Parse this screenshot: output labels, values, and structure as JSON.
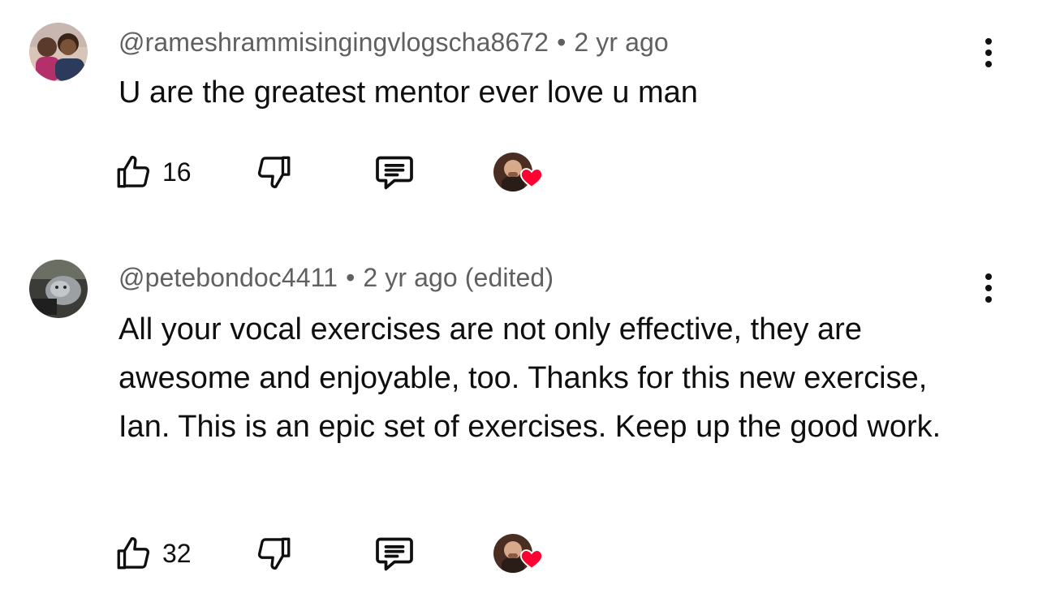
{
  "comments": [
    {
      "author": "@rameshrammisingingvlogscha8672",
      "time": "2 yr ago",
      "text": "U are the greatest mentor ever love u man",
      "likes": "16"
    },
    {
      "author": "@petebondoc4411",
      "time": "2 yr ago (edited)",
      "text": "All your vocal exercises are not only effective, they are awesome and enjoyable, too. Thanks for this new exercise, Ian. This is an epic set of exercises. Keep up the good work.",
      "likes": "32"
    }
  ],
  "separator": "•",
  "colors": {
    "heart": "#ff0033",
    "meta_text": "#606060",
    "body_text": "#0f0f0f"
  },
  "icons": [
    "like-icon",
    "dislike-icon",
    "reply-icon",
    "creator-heart-icon",
    "more-options-icon"
  ]
}
